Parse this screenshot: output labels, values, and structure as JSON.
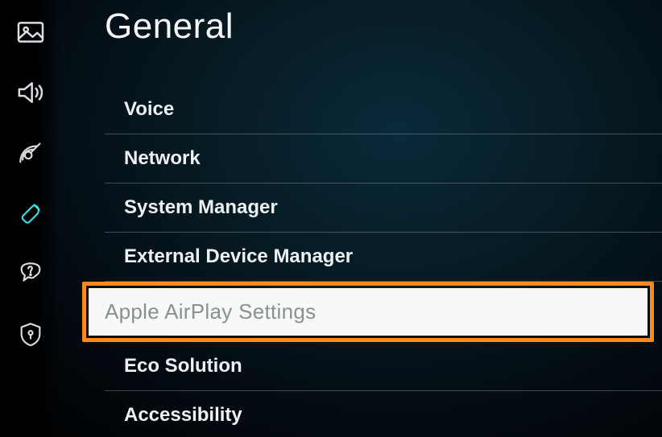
{
  "page_title": "General",
  "menu": {
    "items": [
      {
        "label": "Voice"
      },
      {
        "label": "Network"
      },
      {
        "label": "System Manager"
      },
      {
        "label": "External Device Manager"
      },
      {
        "label": "Apple AirPlay Settings",
        "highlighted": true
      },
      {
        "label": "Eco Solution"
      },
      {
        "label": "Accessibility"
      }
    ]
  },
  "sidebar": {
    "icons": [
      "picture-icon",
      "sound-icon",
      "broadcasting-icon",
      "general-icon",
      "support-icon",
      "privacy-icon"
    ]
  },
  "colors": {
    "accent": "#36e0e6",
    "highlight_border": "#ff8a1c",
    "highlight_bg": "#f7f8f8",
    "highlight_text": "#8b8f92"
  }
}
